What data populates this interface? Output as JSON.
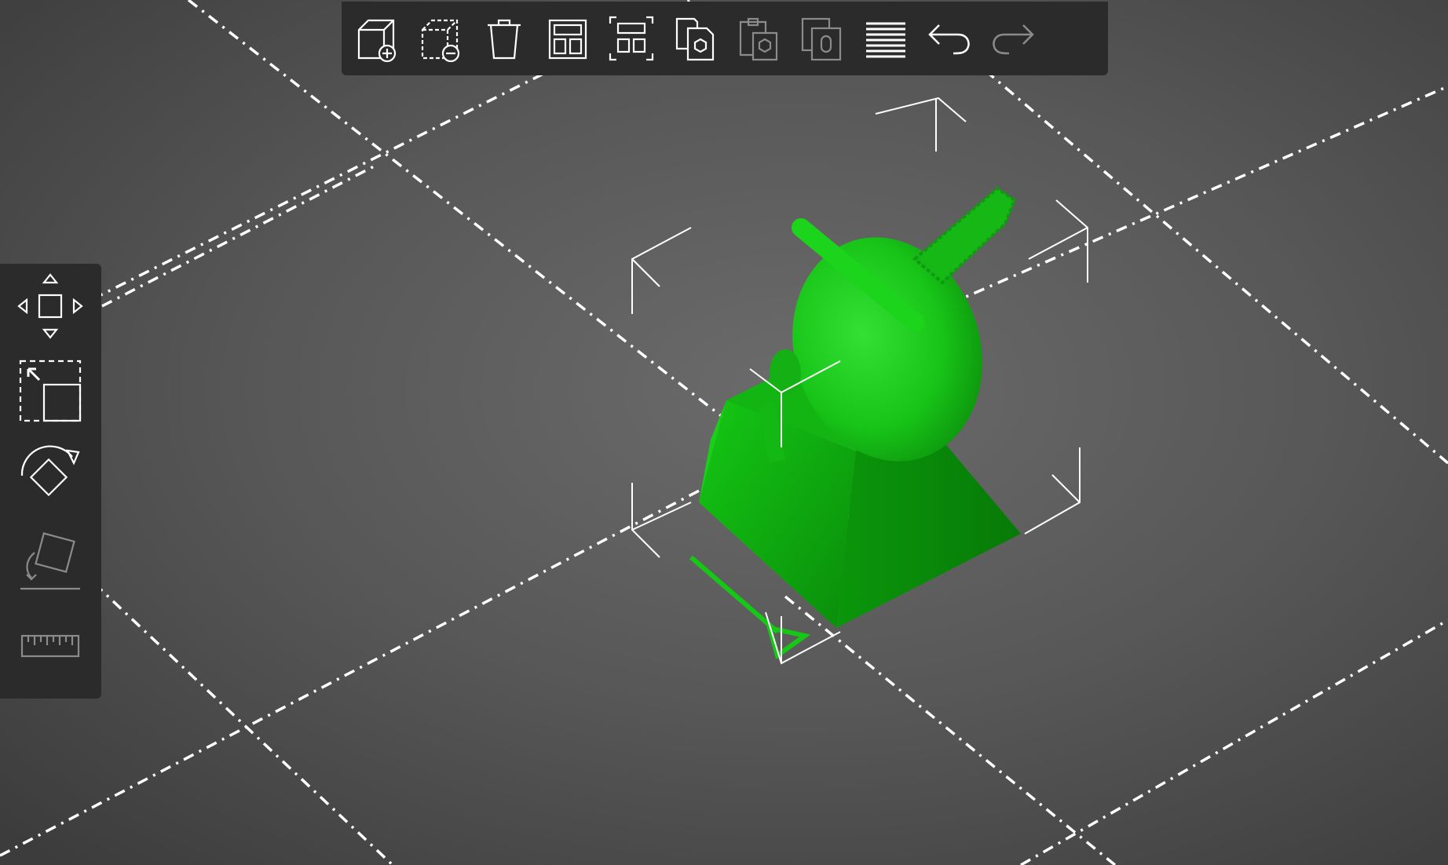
{
  "viewport": {
    "background": "#555555",
    "grid_color": "#ffffff",
    "model_color": "#11cc11",
    "bounding_box_color": "#ffffff"
  },
  "top_toolbar": {
    "buttons": [
      {
        "name": "add-model",
        "icon": "cube-plus-icon",
        "enabled": true
      },
      {
        "name": "remove-model",
        "icon": "dashed-cube-minus-icon",
        "enabled": true
      },
      {
        "name": "delete",
        "icon": "trash-icon",
        "enabled": true
      },
      {
        "name": "arrange",
        "icon": "layout-icon",
        "enabled": true
      },
      {
        "name": "auto-orient",
        "icon": "frame-layout-icon",
        "enabled": true
      },
      {
        "name": "copy",
        "icon": "copy-icon",
        "enabled": true
      },
      {
        "name": "paste",
        "icon": "paste-icon",
        "enabled": false
      },
      {
        "name": "clone",
        "icon": "clone-icon",
        "enabled": false
      },
      {
        "name": "slice-layers",
        "icon": "layers-icon",
        "enabled": true
      },
      {
        "name": "undo",
        "icon": "undo-icon",
        "enabled": true
      },
      {
        "name": "redo",
        "icon": "redo-icon",
        "enabled": false
      }
    ]
  },
  "left_toolbar": {
    "tools": [
      {
        "name": "move",
        "icon": "move-icon",
        "enabled": true
      },
      {
        "name": "scale",
        "icon": "scale-icon",
        "enabled": true
      },
      {
        "name": "rotate",
        "icon": "rotate-icon",
        "enabled": true
      },
      {
        "name": "lay-flat",
        "icon": "lay-flat-icon",
        "enabled": false
      },
      {
        "name": "measure",
        "icon": "ruler-icon",
        "enabled": false
      }
    ]
  }
}
